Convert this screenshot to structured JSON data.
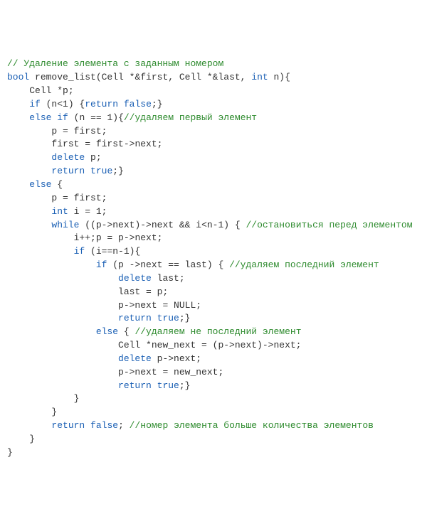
{
  "code": {
    "lines": [
      {
        "indent": 0,
        "spans": [
          {
            "cls": "c-comment",
            "t": "// Удаление элемента с заданным номером"
          }
        ]
      },
      {
        "indent": 0,
        "spans": [
          {
            "cls": "c-keyword",
            "t": "bool"
          },
          {
            "cls": "c-plain",
            "t": " remove_list(Cell *&first, Cell *&last, "
          },
          {
            "cls": "c-keyword",
            "t": "int"
          },
          {
            "cls": "c-plain",
            "t": " n){"
          }
        ]
      },
      {
        "indent": 1,
        "spans": [
          {
            "cls": "c-plain",
            "t": "Cell *p;"
          }
        ]
      },
      {
        "indent": 1,
        "spans": [
          {
            "cls": "c-keyword",
            "t": "if"
          },
          {
            "cls": "c-plain",
            "t": " (n<1) {"
          },
          {
            "cls": "c-keyword",
            "t": "return"
          },
          {
            "cls": "c-plain",
            "t": " "
          },
          {
            "cls": "c-keyword",
            "t": "false"
          },
          {
            "cls": "c-plain",
            "t": ";}"
          }
        ]
      },
      {
        "indent": 1,
        "spans": [
          {
            "cls": "c-keyword",
            "t": "else"
          },
          {
            "cls": "c-plain",
            "t": " "
          },
          {
            "cls": "c-keyword",
            "t": "if"
          },
          {
            "cls": "c-plain",
            "t": " (n == 1){"
          },
          {
            "cls": "c-comment",
            "t": "//удаляем первый элемент"
          }
        ]
      },
      {
        "indent": 2,
        "spans": [
          {
            "cls": "c-plain",
            "t": "p = first;"
          }
        ]
      },
      {
        "indent": 2,
        "spans": [
          {
            "cls": "c-plain",
            "t": "first = first->next;"
          }
        ]
      },
      {
        "indent": 2,
        "spans": [
          {
            "cls": "c-keyword",
            "t": "delete"
          },
          {
            "cls": "c-plain",
            "t": " p;"
          }
        ]
      },
      {
        "indent": 2,
        "spans": [
          {
            "cls": "c-keyword",
            "t": "return"
          },
          {
            "cls": "c-plain",
            "t": " "
          },
          {
            "cls": "c-keyword",
            "t": "true"
          },
          {
            "cls": "c-plain",
            "t": ";}"
          }
        ]
      },
      {
        "indent": 1,
        "spans": [
          {
            "cls": "c-keyword",
            "t": "else"
          },
          {
            "cls": "c-plain",
            "t": " {"
          }
        ]
      },
      {
        "indent": 2,
        "spans": [
          {
            "cls": "c-plain",
            "t": "p = first;"
          }
        ]
      },
      {
        "indent": 2,
        "spans": [
          {
            "cls": "c-keyword",
            "t": "int"
          },
          {
            "cls": "c-plain",
            "t": " i = 1;"
          }
        ]
      },
      {
        "indent": 2,
        "spans": [
          {
            "cls": "c-keyword",
            "t": "while"
          },
          {
            "cls": "c-plain",
            "t": " ((p->next)->next && i<n-1) { "
          },
          {
            "cls": "c-comment",
            "t": "//остановиться перед элементом"
          }
        ]
      },
      {
        "indent": 3,
        "spans": [
          {
            "cls": "c-plain",
            "t": "i++;p = p->next;"
          }
        ]
      },
      {
        "indent": 3,
        "spans": [
          {
            "cls": "c-keyword",
            "t": "if"
          },
          {
            "cls": "c-plain",
            "t": " (i==n-1){"
          }
        ]
      },
      {
        "indent": 4,
        "spans": [
          {
            "cls": "c-keyword",
            "t": "if"
          },
          {
            "cls": "c-plain",
            "t": " (p ->next == last) { "
          },
          {
            "cls": "c-comment",
            "t": "//удаляем последний элемент"
          }
        ]
      },
      {
        "indent": 5,
        "spans": [
          {
            "cls": "c-keyword",
            "t": "delete"
          },
          {
            "cls": "c-plain",
            "t": " last;"
          }
        ]
      },
      {
        "indent": 5,
        "spans": [
          {
            "cls": "c-plain",
            "t": "last = p;"
          }
        ]
      },
      {
        "indent": 5,
        "spans": [
          {
            "cls": "c-plain",
            "t": "p->next = NULL;"
          }
        ]
      },
      {
        "indent": 5,
        "spans": [
          {
            "cls": "c-keyword",
            "t": "return"
          },
          {
            "cls": "c-plain",
            "t": " "
          },
          {
            "cls": "c-keyword",
            "t": "true"
          },
          {
            "cls": "c-plain",
            "t": ";}"
          }
        ]
      },
      {
        "indent": 4,
        "spans": [
          {
            "cls": "c-keyword",
            "t": "else"
          },
          {
            "cls": "c-plain",
            "t": " { "
          },
          {
            "cls": "c-comment",
            "t": "//удаляем не последний элемент"
          }
        ]
      },
      {
        "indent": 5,
        "spans": [
          {
            "cls": "c-plain",
            "t": "Cell *new_next = (p->next)->next;"
          }
        ]
      },
      {
        "indent": 5,
        "spans": [
          {
            "cls": "c-keyword",
            "t": "delete"
          },
          {
            "cls": "c-plain",
            "t": " p->next;"
          }
        ]
      },
      {
        "indent": 5,
        "spans": [
          {
            "cls": "c-plain",
            "t": "p->next = new_next;"
          }
        ]
      },
      {
        "indent": 5,
        "spans": [
          {
            "cls": "c-keyword",
            "t": "return"
          },
          {
            "cls": "c-plain",
            "t": " "
          },
          {
            "cls": "c-keyword",
            "t": "true"
          },
          {
            "cls": "c-plain",
            "t": ";}"
          }
        ]
      },
      {
        "indent": 3,
        "spans": [
          {
            "cls": "c-plain",
            "t": "}"
          }
        ]
      },
      {
        "indent": 2,
        "spans": [
          {
            "cls": "c-plain",
            "t": "}"
          }
        ]
      },
      {
        "indent": 2,
        "spans": [
          {
            "cls": "c-keyword",
            "t": "return"
          },
          {
            "cls": "c-plain",
            "t": " "
          },
          {
            "cls": "c-keyword",
            "t": "false"
          },
          {
            "cls": "c-plain",
            "t": "; "
          },
          {
            "cls": "c-comment",
            "t": "//номер элемента больше количества элементов"
          }
        ]
      },
      {
        "indent": 1,
        "spans": [
          {
            "cls": "c-plain",
            "t": "}"
          }
        ]
      },
      {
        "indent": 0,
        "spans": [
          {
            "cls": "c-plain",
            "t": "}"
          }
        ]
      }
    ],
    "indent_unit": "    "
  }
}
